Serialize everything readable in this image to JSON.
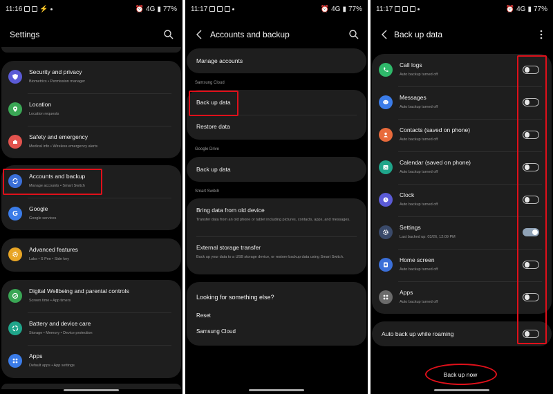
{
  "panel1": {
    "status": {
      "time": "11:16",
      "battery": "77%",
      "network": "4G"
    },
    "title": "Settings",
    "groups": [
      [
        {
          "title": "Security and privacy",
          "subtitle": "Biometrics • Permission manager",
          "icon": "shield-icon",
          "color": "#5b5bd6"
        },
        {
          "title": "Location",
          "subtitle": "Location requests",
          "icon": "location-pin-icon",
          "color": "#3aa755"
        },
        {
          "title": "Safety and emergency",
          "subtitle": "Medical info • Wireless emergency alerts",
          "icon": "emergency-icon",
          "color": "#e2534e"
        }
      ],
      [
        {
          "title": "Accounts and backup",
          "subtitle": "Manage accounts • Smart Switch",
          "icon": "sync-icon",
          "color": "#3b6fd8"
        },
        {
          "title": "Google",
          "subtitle": "Google services",
          "icon": "google-icon",
          "color": "#3b7ce8"
        }
      ],
      [
        {
          "title": "Advanced features",
          "subtitle": "Labs • S Pen • Side key",
          "icon": "gear-plus-icon",
          "color": "#e8a525"
        }
      ],
      [
        {
          "title": "Digital Wellbeing and parental controls",
          "subtitle": "Screen time • App timers",
          "icon": "wellbeing-icon",
          "color": "#3aa755"
        },
        {
          "title": "Battery and device care",
          "subtitle": "Storage • Memory • Device protection",
          "icon": "device-care-icon",
          "color": "#1fa58a"
        },
        {
          "title": "Apps",
          "subtitle": "Default apps • App settings",
          "icon": "apps-grid-icon",
          "color": "#3b7ce8"
        }
      ]
    ]
  },
  "panel2": {
    "status": {
      "time": "11:17",
      "battery": "77%",
      "network": "4G"
    },
    "title": "Accounts and backup",
    "manage_accounts": "Manage accounts",
    "samsung_cloud_header": "Samsung Cloud",
    "backup_data": "Back up data",
    "restore_data": "Restore data",
    "google_drive_header": "Google Drive",
    "gdrive_backup": "Back up data",
    "smart_switch_header": "Smart Switch",
    "bring_data": "Bring data from old device",
    "bring_data_desc": "Transfer data from an old phone or tablet including pictures, contacts, apps, and messages.",
    "external_storage": "External storage transfer",
    "external_storage_desc": "Back up your data to a USB storage device, or restore backup data using Smart Switch.",
    "looking": "Looking for something else?",
    "reset": "Reset",
    "samsung_cloud_link": "Samsung Cloud"
  },
  "panel3": {
    "status": {
      "time": "11:17",
      "battery": "77%",
      "network": "4G"
    },
    "title": "Back up data",
    "items": [
      {
        "title": "Call logs",
        "subtitle": "Auto backup turned off",
        "icon": "phone-icon",
        "color": "#2fb86a",
        "on": false
      },
      {
        "title": "Messages",
        "subtitle": "Auto backup turned off",
        "icon": "message-icon",
        "color": "#3b7ce8",
        "on": false
      },
      {
        "title": "Contacts (saved on phone)",
        "subtitle": "Auto backup turned off",
        "icon": "contact-icon",
        "color": "#e86a3b",
        "on": false
      },
      {
        "title": "Calendar (saved on phone)",
        "subtitle": "Auto backup turned off",
        "icon": "calendar-icon",
        "color": "#1fa58a",
        "on": false
      },
      {
        "title": "Clock",
        "subtitle": "Auto backup turned off",
        "icon": "clock-icon",
        "color": "#5b5bd6",
        "on": false
      },
      {
        "title": "Settings",
        "subtitle": "Last backed up: 03/26, 12:09 PM",
        "icon": "gear-icon",
        "color": "#3a4a6a",
        "on": true
      },
      {
        "title": "Home screen",
        "subtitle": "Auto backup turned off",
        "icon": "home-screen-icon",
        "color": "#3b6fd8",
        "on": false
      },
      {
        "title": "Apps",
        "subtitle": "Auto backup turned off",
        "icon": "apps-grid-icon",
        "color": "#6b6b6b",
        "on": false
      }
    ],
    "roaming_label": "Auto back up while roaming",
    "roaming_on": false,
    "backup_now": "Back up now"
  },
  "colors": {
    "highlight": "#e0101a",
    "card": "#1e1e1e",
    "background": "#000000"
  }
}
